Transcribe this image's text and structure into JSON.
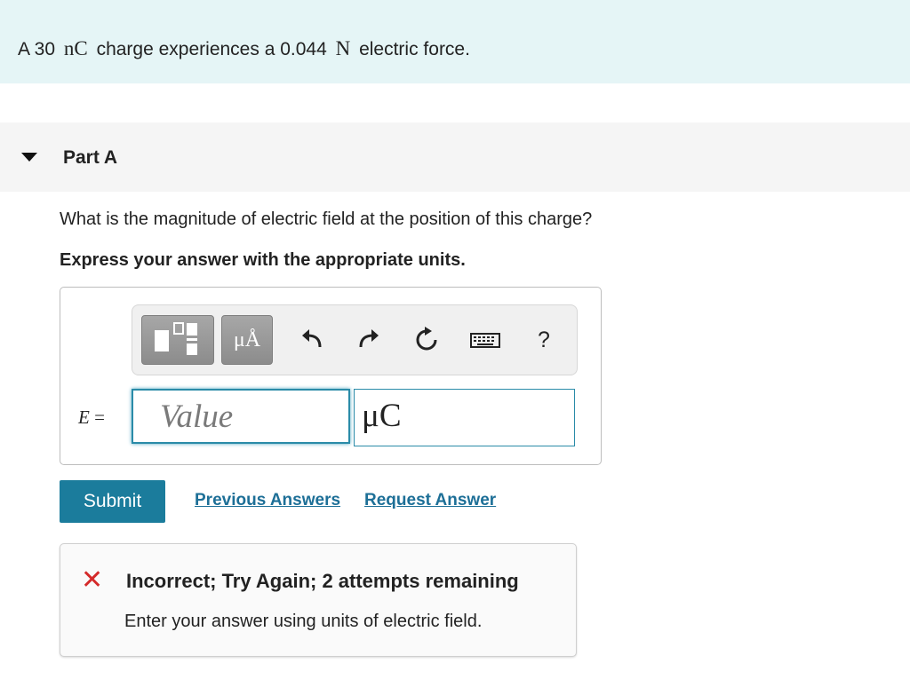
{
  "problem": {
    "prefix": "A 30",
    "charge_unit": "nC",
    "middle": "charge experiences a 0.044",
    "force_unit": "N",
    "suffix": "electric force."
  },
  "part": {
    "title": "Part A",
    "question": "What is the magnitude of electric field at the position of this charge?",
    "instruction": "Express your answer with the appropriate units."
  },
  "toolbar": {
    "units_label": "μÅ",
    "help_label": "?"
  },
  "answer": {
    "variable": "E",
    "equals": "=",
    "value_placeholder": "Value",
    "unit_value": "μC"
  },
  "actions": {
    "submit_label": "Submit",
    "previous_answers_label": "Previous Answers",
    "request_answer_label": "Request Answer"
  },
  "feedback": {
    "title": "Incorrect; Try Again; 2 attempts remaining",
    "message": "Enter your answer using units of electric field.",
    "status_color": "#d42a2a"
  },
  "colors": {
    "banner_bg": "#e5f5f6",
    "accent": "#1b7c9c",
    "link": "#1d6f97"
  }
}
